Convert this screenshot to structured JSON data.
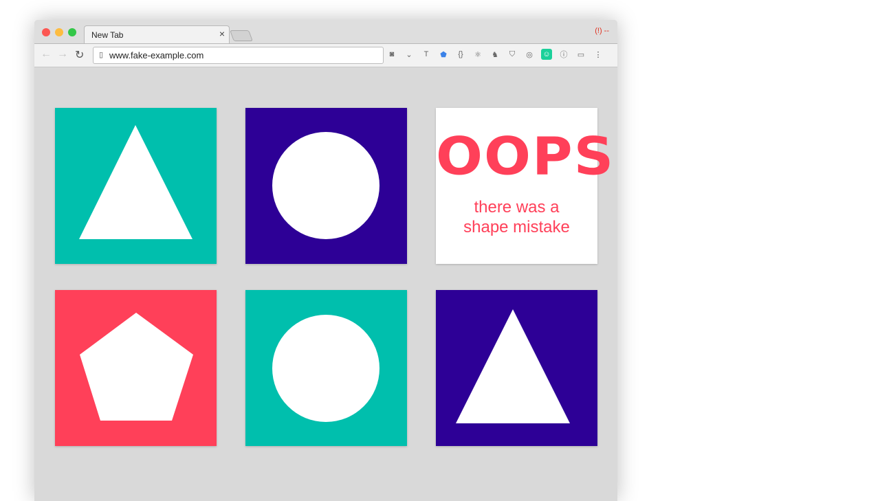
{
  "browser": {
    "tab_title": "New Tab",
    "tab_close": "×",
    "url": "www.fake-example.com",
    "extension_top_label": "(!) --",
    "extensions": [
      "camera-icon",
      "pocket-icon",
      "text-icon",
      "shield-blue-icon",
      "json-icon",
      "react-icon",
      "evernote-icon",
      "ublock-icon",
      "target-icon",
      "face-icon",
      "info-icon",
      "calendar-icon"
    ]
  },
  "colors": {
    "teal": "#00bfad",
    "purple": "#2d0096",
    "pink": "#ff4059"
  },
  "cards": [
    {
      "shape": "triangle",
      "color": "#00bfad"
    },
    {
      "shape": "circle",
      "color": "#2d0096"
    },
    {
      "shape": "error",
      "color": "#ffffff"
    },
    {
      "shape": "pentagon",
      "color": "#ff4059"
    },
    {
      "shape": "circle",
      "color": "#00bfad"
    },
    {
      "shape": "triangle",
      "color": "#2d0096"
    }
  ],
  "error_card": {
    "title": "OOPS",
    "line1": "there was a",
    "line2": "shape mistake"
  }
}
